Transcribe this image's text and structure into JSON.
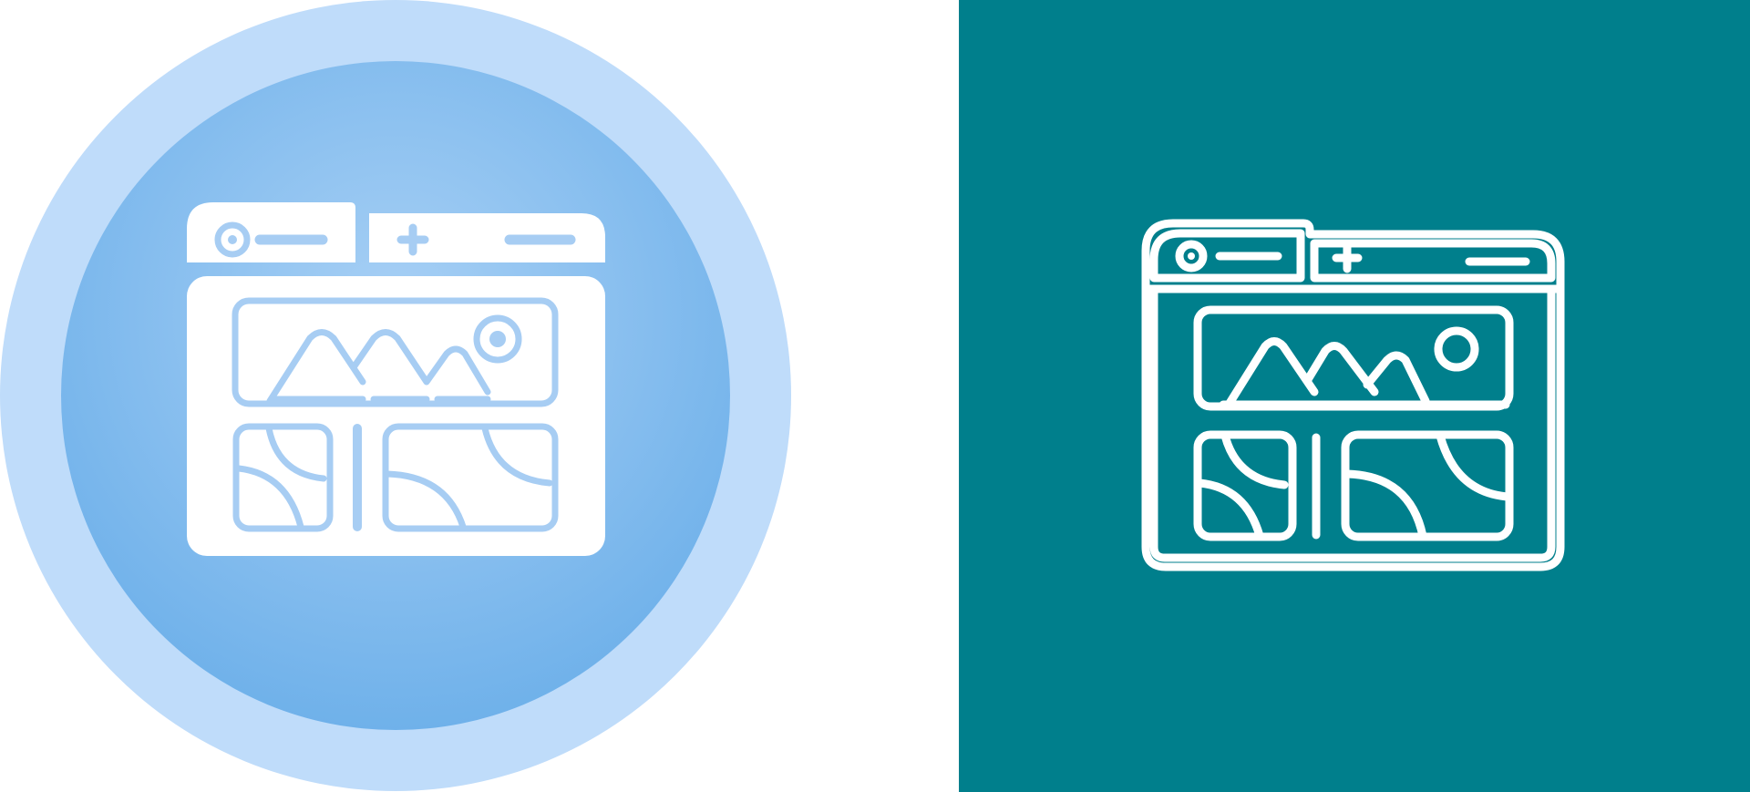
{
  "variants": [
    {
      "name": "filled-gradient-circle",
      "icon": "web-gallery-icon",
      "colors": {
        "outer_ring": "#bfdcfa",
        "inner_circle_top": "#6fb1ea",
        "inner_circle_bottom": "#a8d0f5",
        "glyph": "#ffffff",
        "cutout": "#a7cdf3"
      }
    },
    {
      "name": "outline-teal-square",
      "icon": "web-gallery-icon",
      "colors": {
        "background": "#007f8c",
        "stroke": "#ffffff"
      }
    }
  ]
}
